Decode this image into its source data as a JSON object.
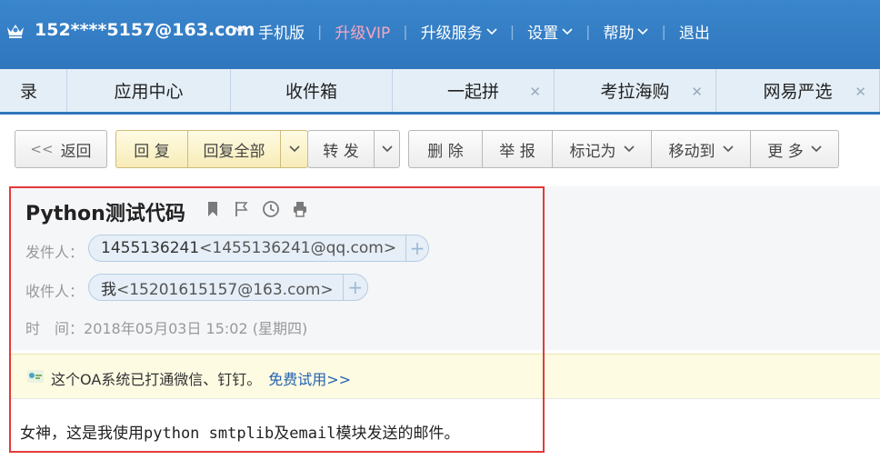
{
  "header": {
    "account": "152****5157@163.com",
    "nav": [
      {
        "label": "手机版",
        "has_caret": false,
        "vip": false
      },
      {
        "label": "升级VIP",
        "has_caret": false,
        "vip": true
      },
      {
        "label": "升级服务",
        "has_caret": true,
        "vip": false
      },
      {
        "label": "设置",
        "has_caret": true,
        "vip": false
      },
      {
        "label": "帮助",
        "has_caret": true,
        "vip": false
      },
      {
        "label": "退出",
        "has_caret": false,
        "vip": false
      }
    ],
    "colors": {
      "bar": "#3a86cc",
      "vip": "#f7a7c0"
    }
  },
  "tabs": [
    {
      "label": "录",
      "closable": false
    },
    {
      "label": "应用中心",
      "closable": false
    },
    {
      "label": "收件箱",
      "closable": false
    },
    {
      "label": "一起拼",
      "closable": true
    },
    {
      "label": "考拉海购",
      "closable": true
    },
    {
      "label": "网易严选",
      "closable": true
    }
  ],
  "toolbar": {
    "back": "返回",
    "reply": "回 复",
    "reply_all": "回复全部",
    "forward": "转 发",
    "delete": "删 除",
    "report": "举 报",
    "mark_as": "标记为",
    "move_to": "移动到",
    "more": "更 多"
  },
  "mail": {
    "subject": "Python测试代码",
    "icons": [
      "bookmark-icon",
      "flag-icon",
      "clock-icon",
      "print-icon"
    ],
    "from_label": "发件人：",
    "from_name": "1455136241",
    "from_addr": "<1455136241@qq.com>",
    "to_label": "收件人：",
    "to_name": "我",
    "to_addr": "<15201615157@163.com>",
    "time_label": "时　间：",
    "time_value": "2018年05月03日 15:02 (星期四)",
    "body": "女神，这是我使用python smtplib及email模块发送的邮件。"
  },
  "notice": {
    "text": "这个OA系统已打通微信、钉钉。",
    "link": "免费试用>>"
  },
  "highlight_color": "#e33a3a"
}
